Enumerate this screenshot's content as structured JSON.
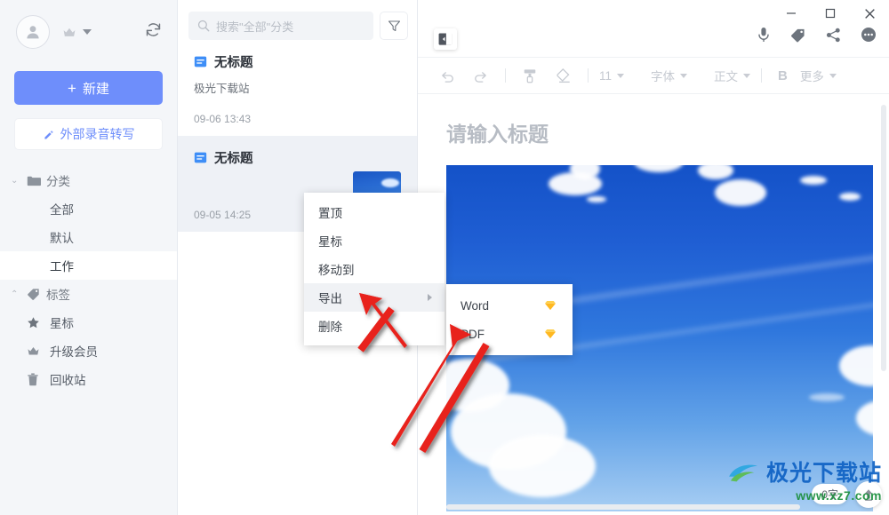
{
  "sidebar": {
    "account": {
      "avatar_icon": "user-avatar-icon",
      "crown_icon": "crown-icon",
      "dropdown_icon": "chevron-down-icon",
      "sync_icon": "sync-refresh-icon"
    },
    "new_button": {
      "plus": "+",
      "label": "新建"
    },
    "record_button": {
      "icon": "pencil-icon",
      "label": "外部录音转写"
    },
    "groups": [
      {
        "label": "分类",
        "icon": "folder-icon",
        "expanded": true,
        "chevron": "⌄"
      },
      {
        "label": "标签",
        "icon": "tag-icon",
        "expanded": false,
        "chevron": "⌃"
      }
    ],
    "category_items": [
      {
        "label": "全部",
        "selected": false
      },
      {
        "label": "默认",
        "selected": false
      },
      {
        "label": "工作",
        "selected": true
      }
    ],
    "bottom_items": [
      {
        "label": "星标",
        "icon": "star-icon"
      },
      {
        "label": "升级会员",
        "icon": "crown-icon"
      },
      {
        "label": "回收站",
        "icon": "trash-icon"
      }
    ]
  },
  "list": {
    "search": {
      "placeholder": "搜索\"全部\"分类",
      "icon": "search-icon"
    },
    "filter_icon": "filter-funnel-icon",
    "notes": [
      {
        "title": "无标题",
        "snippet": "极光下载站",
        "date": "09-06 13:43",
        "active": false,
        "doc_icon": "document-icon"
      },
      {
        "title": "无标题",
        "snippet": "",
        "date": "09-05 14:25",
        "active": true,
        "doc_icon": "document-icon"
      }
    ]
  },
  "window": {
    "minimize": "minimize-icon",
    "maximize": "maximize-icon",
    "close": "close-icon"
  },
  "editor": {
    "collapse_icon": "panel-collapse-icon",
    "actions": [
      {
        "name": "microphone-icon"
      },
      {
        "name": "tag-icon"
      },
      {
        "name": "share-icon"
      },
      {
        "name": "more-options-icon"
      }
    ],
    "toolbar": {
      "undo_icon": "undo-icon",
      "redo_icon": "redo-icon",
      "format_painter_icon": "format-painter-icon",
      "eraser_icon": "clear-format-eraser-icon",
      "font_size": "11",
      "font_family_label": "字体",
      "paragraph_style_label": "正文",
      "bold_label": "B",
      "more_label": "更多"
    },
    "title_placeholder": "请输入标题",
    "word_count": "0字",
    "scroll_top_icon": "scroll-to-top-icon"
  },
  "context_menu": {
    "items": [
      {
        "label": "置顶",
        "highlighted": false,
        "has_submenu": false
      },
      {
        "label": "星标",
        "highlighted": false,
        "has_submenu": false
      },
      {
        "label": "移动到",
        "highlighted": false,
        "has_submenu": false
      },
      {
        "label": "导出",
        "highlighted": true,
        "has_submenu": true
      },
      {
        "label": "删除",
        "highlighted": false,
        "has_submenu": false
      }
    ],
    "submenu": {
      "items": [
        {
          "label": "Word",
          "badge_icon": "vip-diamond-icon"
        },
        {
          "label": "PDF",
          "badge_icon": "vip-diamond-icon"
        }
      ]
    }
  },
  "watermark": {
    "main": "极光下载站",
    "sub": "www.xz7.com",
    "logo_icon": "swoosh-logo-icon"
  },
  "colors": {
    "accent_blue": "#6e8efb",
    "sidebar_bg": "#f4f6f9",
    "selected_note_bg": "#eef1f6",
    "menu_highlight": "#f0f2f5",
    "vip_gold": "#ffb821",
    "annotation_red": "#e8231b"
  }
}
